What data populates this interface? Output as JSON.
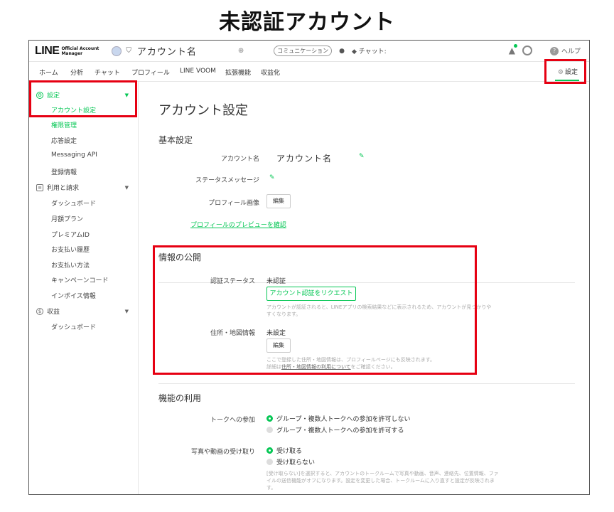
{
  "page_heading": "未認証アカウント",
  "header": {
    "logo_main": "LINE",
    "logo_sub_1": "Official Account",
    "logo_sub_2": "Manager",
    "account_name": "アカウント名",
    "category_tag": "コミュニケーション",
    "chat_status": "チャット:",
    "help_label": "ヘルプ",
    "help_icon_glyph": "?"
  },
  "nav": {
    "tabs": [
      "ホーム",
      "分析",
      "チャット",
      "プロフィール",
      "LINE VOOM",
      "拡張機能",
      "収益化"
    ],
    "settings_label": "設定"
  },
  "sidebar": {
    "settings_header": "設定",
    "settings_items": [
      "アカウント設定",
      "権限管理",
      "応答設定",
      "Messaging API",
      "登録情報"
    ],
    "billing_header": "利用と請求",
    "billing_items": [
      "ダッシュボード",
      "月額プラン",
      "プレミアムID",
      "お支払い履歴",
      "お支払い方法",
      "キャンペーンコード",
      "インボイス情報"
    ],
    "revenue_header": "収益",
    "revenue_items": [
      "ダッシュボード"
    ]
  },
  "main": {
    "title": "アカウント設定",
    "basic": {
      "heading": "基本設定",
      "account_name_label": "アカウント名",
      "account_name_value": "アカウント名",
      "status_message_label": "ステータスメッセージ",
      "profile_image_label": "プロフィール画像",
      "edit_button": "編集",
      "preview_link": "プロフィールのプレビューを確認"
    },
    "disclosure": {
      "heading": "情報の公開",
      "verify_label": "認証ステータス",
      "verify_value": "未認証",
      "verify_button": "アカウント認証をリクエスト",
      "verify_help": "アカウントが認証されると、LINEアプリの検索結果などに表示されるため、アカウントが見つかりやすくなります。",
      "address_label": "住所・地図情報",
      "address_value": "未設定",
      "edit_button": "編集",
      "address_help_1": "ここで登録した住所・地図情報は、プロフィールページにも反映されます。",
      "address_help_2_pre": "詳細は",
      "address_help_2_link": "住所・地図情報の利用について",
      "address_help_2_post": "をご確認ください。"
    },
    "features": {
      "heading": "機能の利用",
      "talk_label": "トークへの参加",
      "talk_options": [
        "グループ・複数人トークへの参加を許可しない",
        "グループ・複数人トークへの参加を許可する"
      ],
      "talk_selected": 0,
      "media_label": "写真や動画の受け取り",
      "media_options": [
        "受け取る",
        "受け取らない"
      ],
      "media_selected": 0,
      "media_help": "[受け取らない]を選択すると、アカウントのトークルームで写真や動画、音声、連絡先、位置情報、ファイルの送信機能がオフになります。設定を変更した場合、トークルームに入り直すと設定が反映されます。"
    }
  },
  "colors": {
    "accent": "#06c755",
    "highlight": "#e60012"
  }
}
